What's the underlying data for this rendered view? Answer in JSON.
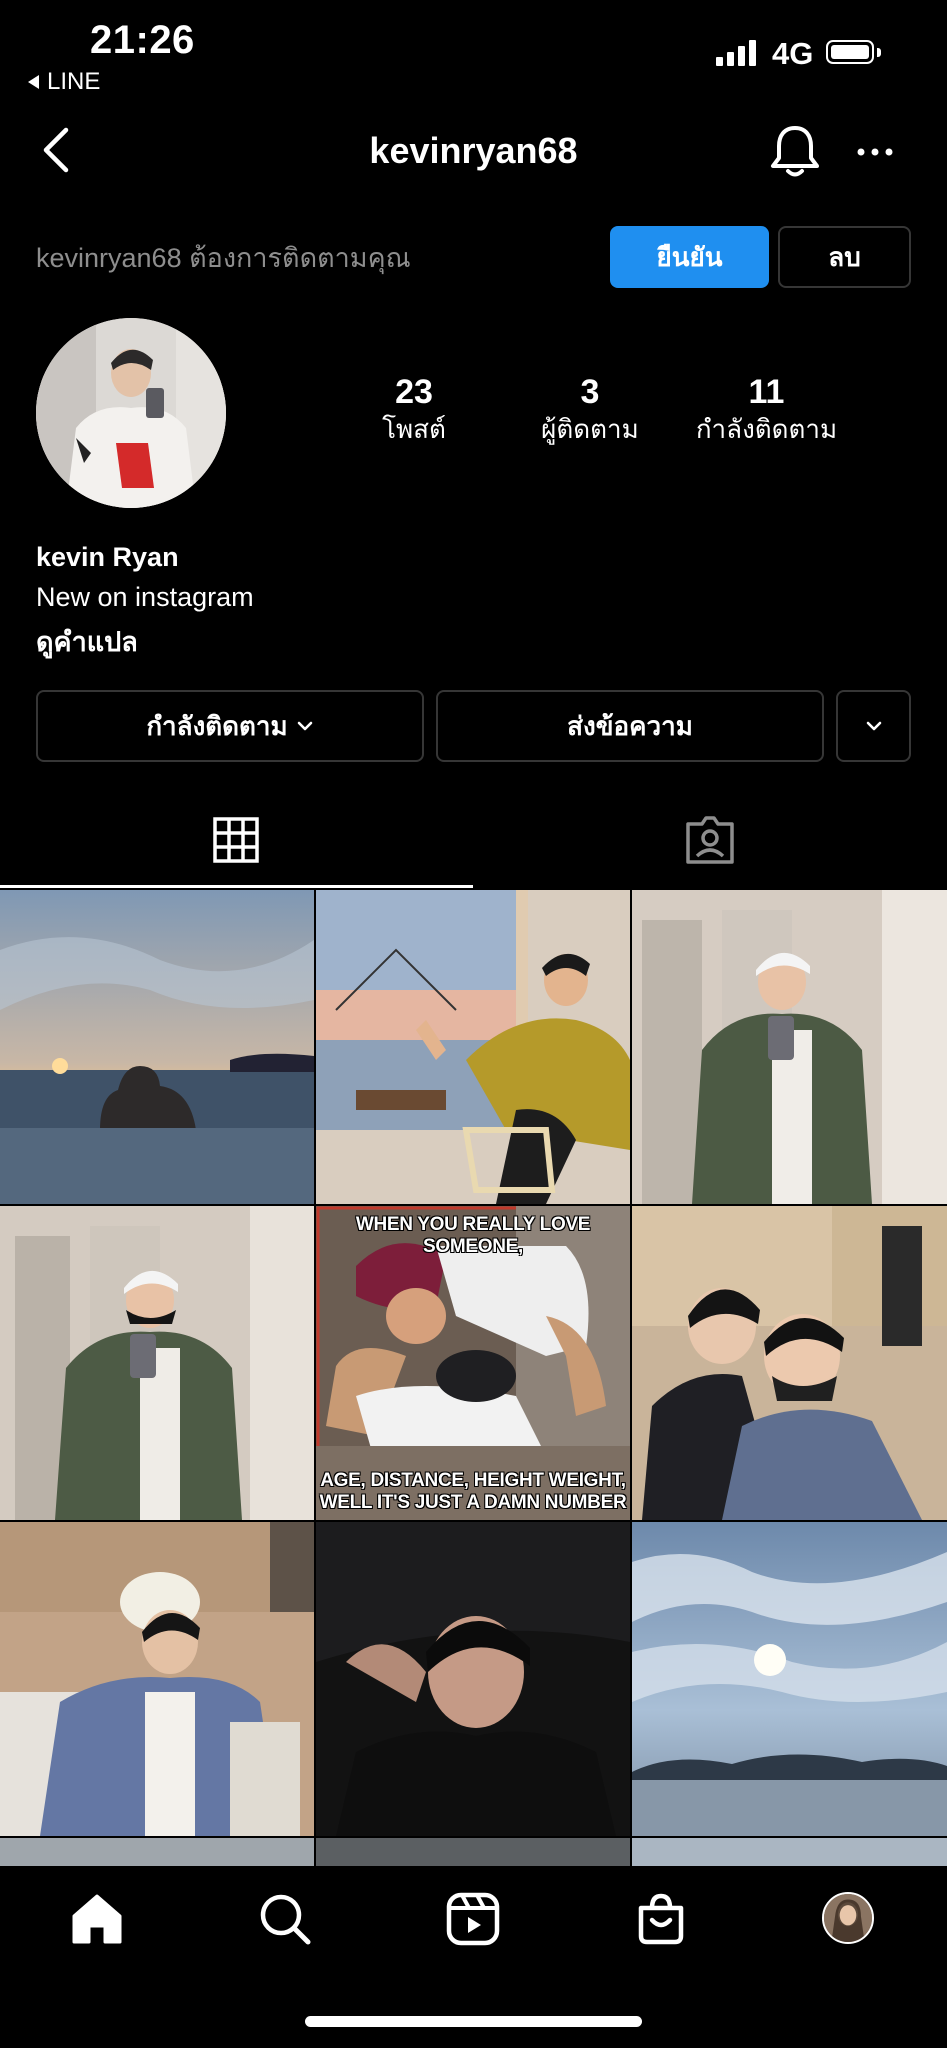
{
  "status_bar": {
    "time": "21:26",
    "back_app": "LINE",
    "network": "4G"
  },
  "header": {
    "username": "kevinryan68"
  },
  "follow_request": {
    "text": "kevinryan68 ต้องการติดตามคุณ",
    "confirm_label": "ยืนยัน",
    "delete_label": "ลบ"
  },
  "profile": {
    "stats": [
      {
        "value": "23",
        "label": "โพสต์"
      },
      {
        "value": "3",
        "label": "ผู้ติดตาม"
      },
      {
        "value": "11",
        "label": "กำลังติดตาม"
      }
    ],
    "name": "kevin Ryan",
    "bio": "New on instagram",
    "translate": "ดูคำแปล"
  },
  "actions": {
    "following_label": "กำลังติดตาม",
    "message_label": "ส่งข้อความ"
  },
  "grid": {
    "meme_top": "WHEN YOU REALLY LOVE SOMEONE,",
    "meme_bottom_1": "AGE, DISTANCE, HEIGHT WEIGHT,",
    "meme_bottom_2": "WELL IT'S JUST A DAMN NUMBER"
  },
  "colors": {
    "accent": "#1f8ff0",
    "background": "#000000",
    "border": "#363636",
    "muted_text": "#8e8e8e"
  },
  "icons": [
    "chevron-left-icon",
    "bell-icon",
    "more-icon",
    "grid-icon",
    "tagged-icon",
    "home-icon",
    "search-icon",
    "reels-icon",
    "shop-icon"
  ]
}
